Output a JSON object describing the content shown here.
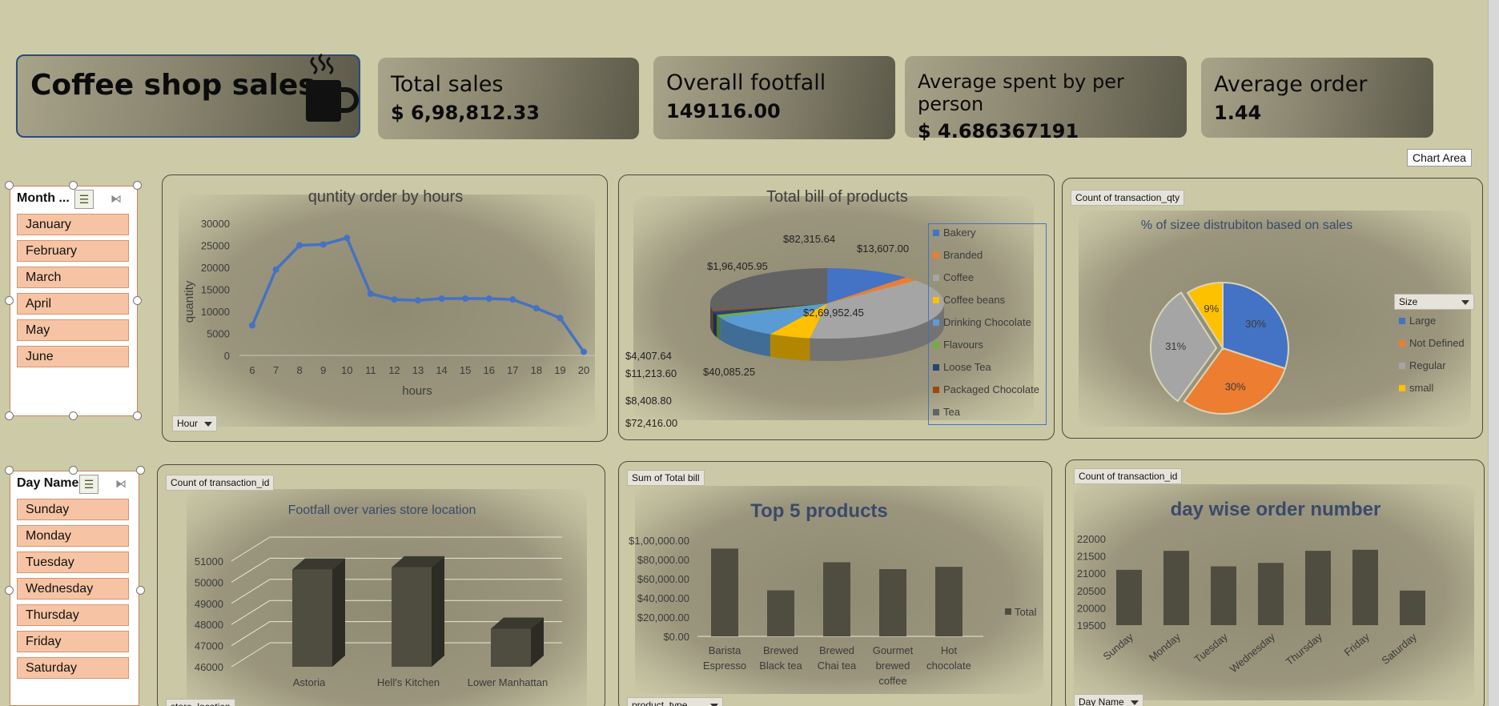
{
  "header": {
    "title": "Coffee shop sales",
    "icon": "coffee-cup-icon"
  },
  "kpis": [
    {
      "title": "Total sales",
      "value": "$ 6,98,812.33"
    },
    {
      "title": "Overall footfall",
      "value": "149116.00"
    },
    {
      "title": "Average spent by per person",
      "value": "$ 4.686367191"
    },
    {
      "title": "Average order",
      "value": "1.44"
    }
  ],
  "chart_area_tooltip": "Chart Area",
  "month_slicer": {
    "header": "Month ...",
    "items": [
      "January",
      "February",
      "March",
      "April",
      "May",
      "June"
    ]
  },
  "day_slicer": {
    "header": "Day Name",
    "items": [
      "Sunday",
      "Monday",
      "Tuesday",
      "Wednesday",
      "Thursday",
      "Friday",
      "Saturday"
    ]
  },
  "hours_chart": {
    "filter_button": "Hour",
    "yticks": [
      "30000",
      "25000",
      "20000",
      "15000",
      "10000",
      "5000",
      "0"
    ]
  },
  "bill_chart": {
    "labels": [
      "$82,315.64",
      "$13,607.00",
      "$1,96,405.95",
      "$2,69,952.45",
      "$4,407.64",
      "$11,213.60",
      "$40,085.25",
      "$8,408.80",
      "$72,416.00"
    ]
  },
  "size_chart": {
    "field_button": "Count  of transaction_qty",
    "legend_title": "Size",
    "labels": [
      "30%",
      "30%",
      "31%",
      "9%"
    ]
  },
  "footfall_chart": {
    "field_button": "Count  of transaction_id",
    "bottom_button": "store_location",
    "yticks": [
      "51000",
      "50000",
      "49000",
      "48000",
      "47000",
      "46000"
    ]
  },
  "top5_chart": {
    "field_button": "Sum of Total bill",
    "bottom_button": "product_type",
    "yticks": [
      "$1,00,000.00",
      "$80,000.00",
      "$60,000.00",
      "$40,000.00",
      "$20,000.00",
      "$0.00"
    ],
    "cat_lines": [
      [
        "Barista",
        "Espresso"
      ],
      [
        "Brewed",
        "Black tea"
      ],
      [
        "Brewed",
        "Chai tea"
      ],
      [
        "Gourmet",
        "brewed",
        "coffee"
      ],
      [
        "Hot",
        "chocolate"
      ]
    ]
  },
  "daywise_chart": {
    "field_button": "Count  of transaction_id",
    "bottom_button": "Day Name",
    "yticks": [
      "22000",
      "21500",
      "21000",
      "20500",
      "20000",
      "19500"
    ]
  },
  "chart_data": [
    {
      "type": "line",
      "title": "quntity order by hours",
      "xlabel": "hours",
      "ylabel": "quantity",
      "x": [
        6,
        7,
        8,
        9,
        10,
        11,
        12,
        13,
        14,
        15,
        16,
        17,
        18,
        19,
        20
      ],
      "values": [
        6800,
        19500,
        25000,
        25200,
        26700,
        14000,
        12700,
        12500,
        12900,
        12900,
        12900,
        12700,
        10700,
        8500,
        800
      ],
      "ylim": [
        0,
        30000
      ],
      "color": "#4472c4"
    },
    {
      "type": "pie",
      "title": "Total bill of products",
      "categories": [
        "Bakery",
        "Branded",
        "Coffee",
        "Coffee beans",
        "Drinking Chocolate",
        "Flavours",
        "Loose Tea",
        "Packaged Chocolate",
        "Tea"
      ],
      "values": [
        82315.64,
        13607.0,
        269952.45,
        40085.25,
        72416.0,
        8408.8,
        11213.6,
        4407.64,
        196405.95
      ],
      "colors": [
        "#4472c4",
        "#ed7d31",
        "#a5a5a5",
        "#ffc000",
        "#5b9bd5",
        "#70ad47",
        "#264478",
        "#9e480e",
        "#636363"
      ],
      "legend": "right"
    },
    {
      "type": "pie",
      "title": "% of sizee distrubiton based on sales",
      "categories": [
        "Large",
        "Not Defined",
        "Regular",
        "small"
      ],
      "values": [
        30,
        30,
        31,
        9
      ],
      "colors": [
        "#4472c4",
        "#ed7d31",
        "#a5a5a5",
        "#ffc000"
      ],
      "legend": "right"
    },
    {
      "type": "bar",
      "title": "Footfall over varies  store location",
      "categories": [
        "Astoria",
        "Hell's Kitchen",
        "Lower Manhattan"
      ],
      "values": [
        50600,
        50700,
        47800
      ],
      "ylim": [
        46000,
        51000
      ],
      "color": "#4f4d40"
    },
    {
      "type": "bar",
      "title": "Top 5 products",
      "categories": [
        "Barista Espresso",
        "Brewed Black tea",
        "Brewed Chai tea",
        "Gourmet brewed coffee",
        "Hot chocolate"
      ],
      "series": [
        {
          "name": "Total",
          "values": [
            91400,
            47900,
            77100,
            70000,
            72400
          ]
        }
      ],
      "ylim": [
        0,
        100000
      ],
      "legend": "right",
      "color": "#4f4d40"
    },
    {
      "type": "bar",
      "title": "day wise order number",
      "categories": [
        "Sunday",
        "Monday",
        "Tuesday",
        "Wednesday",
        "Thursday",
        "Friday",
        "Saturday"
      ],
      "values": [
        21100,
        21650,
        21200,
        21300,
        21650,
        21680,
        20500
      ],
      "ylim": [
        19500,
        22000
      ],
      "color": "#4f4d40"
    }
  ]
}
